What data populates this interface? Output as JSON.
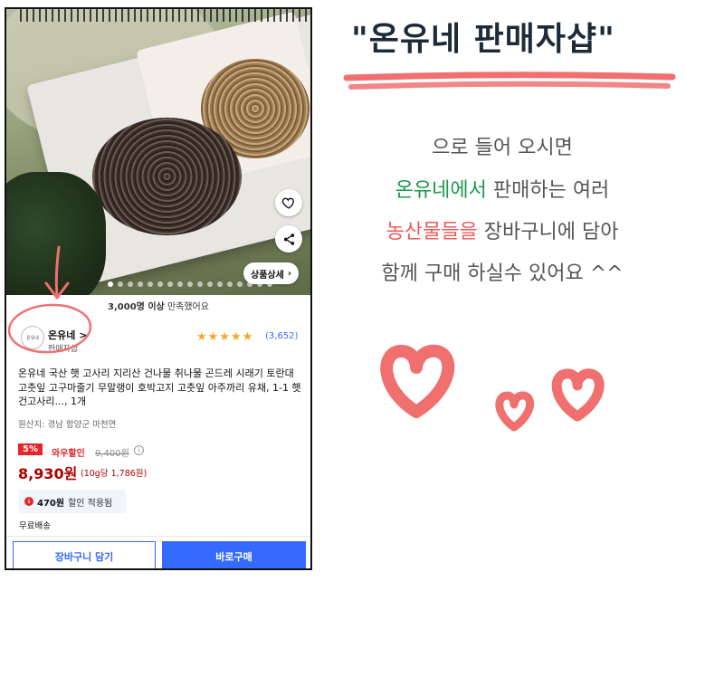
{
  "product": {
    "satisfaction_count": "3,000명 이상",
    "satisfaction_text": "만족했어요",
    "detail_button": "상품상세",
    "seller_logo_text": "온유네",
    "seller_name": "온유네 >",
    "seller_sub": "판매자샵",
    "rating_stars": 5,
    "review_count": "(3,652)",
    "title": "온유네 국산 햇 고사리 지리산 건나물 취나물 곤드레 시래기 토란대 고춧잎 고구마줄기 무말랭이 호박고지 고춧잎 아주까리 유채, 1-1 햇 건고사리..., 1개",
    "origin": "원산지: 경남 함양군 마천면",
    "discount_percent": "5%",
    "discount_label": "와우할인",
    "original_price": "9,400원",
    "price": "8,930원",
    "unit_price": "(10g당 1,786원)",
    "coupon_amount": "470원",
    "coupon_text": "할인 적용됨",
    "shipping": "무료배송",
    "cart_button": "장바구니 담기",
    "buy_button": "바로구매"
  },
  "annotation": {
    "headline": "\"온유네 판매자샵\"",
    "line1": "으로 들어 오시면",
    "line2_highlight": "온유네에서",
    "line2_rest": " 판매하는 여러",
    "line3_highlight": "농산물들을",
    "line3_rest": " 장바구니에 담아",
    "line4": "함께 구매 하실수 있어요 ^^"
  },
  "colors": {
    "accent_blue": "#346aff",
    "price_red": "#ae0000",
    "sale_red": "#e52528",
    "marker_pink": "#f07070",
    "green": "#1a9b4b"
  }
}
